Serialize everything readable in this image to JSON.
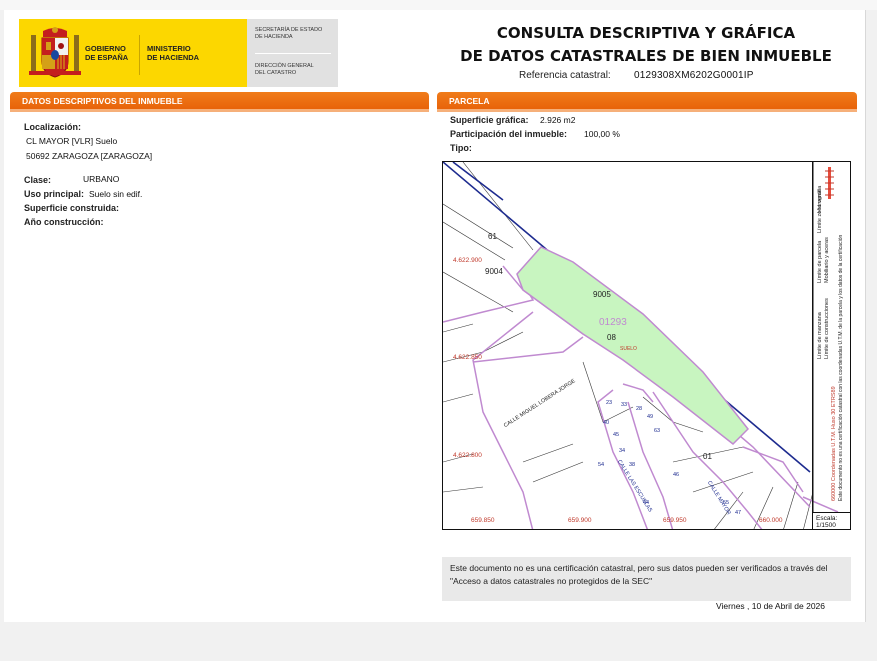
{
  "header": {
    "gov_line1": "GOBIERNO",
    "gov_line2": "DE ESPAÑA",
    "ministry_line1": "MINISTERIO",
    "ministry_line2": "DE HACIENDA",
    "secretaria_line1": "SECRETARÍA DE ESTADO",
    "secretaria_line2": "DE HACIENDA",
    "direccion_line1": "DIRECCIÓN GENERAL",
    "direccion_line2": "DEL CATASTRO",
    "title_line1": "CONSULTA DESCRIPTIVA Y GRÁFICA",
    "title_line2": "DE DATOS CATASTRALES DE BIEN INMUEBLE",
    "ref_label": "Referencia catastral:",
    "ref_value": "0129308XM6202G0001IP"
  },
  "left": {
    "section_title": "DATOS DESCRIPTIVOS DEL INMUEBLE",
    "localizacion_label": "Localización:",
    "address_line1": "CL MAYOR [VLR]  Suelo",
    "address_line2": "50692 ZARAGOZA [ZARAGOZA]",
    "clase_label": "Clase:",
    "clase_value": "URBANO",
    "uso_label": "Uso principal:",
    "uso_value": "Suelo sin edif.",
    "superficie_label": "Superficie construida:",
    "anio_label": "Año construcción:"
  },
  "right": {
    "section_title": "PARCELA",
    "superficie_label": "Superficie gráfica:",
    "superficie_value": "2.926 m2",
    "participacion_label": "Participación del inmueble:",
    "participacion_value": "100,00 %",
    "tipo_label": "Tipo:"
  },
  "map": {
    "parcel_fill": "#c8f5c0",
    "boundary_color": "#c08ad0",
    "road_color": "#1d2b8f",
    "coord_color": "#c0392b",
    "labels": {
      "p61": "61",
      "p9004": "9004",
      "p9005": "9005",
      "parcel_id": "01293",
      "p08": "08",
      "suelo": "SUELO",
      "p01": "01",
      "street1": "CALLE MIGUEL LOBERA JORGE",
      "street2": "CALLE LAS ESCUELAS",
      "street3": "CALLE MAYOR",
      "n1": "23",
      "n2": "33",
      "n3": "28",
      "n4": "49",
      "n5": "63",
      "n6": "40",
      "n7": "45",
      "n8": "34",
      "n9": "38",
      "n10": "46",
      "n11": "54",
      "n12": "55",
      "n13": "47",
      "n14": "44"
    },
    "coords": {
      "y1": "4.622.900",
      "y2": "4.622.850",
      "y3": "4.622.800",
      "x1": "659.850",
      "x2": "659.900",
      "x3": "659.950",
      "x4": "660.000"
    },
    "legend": {
      "l1": "Límite de manzana",
      "l2": "Límite de parcela",
      "l3": "Límite de construcciones",
      "l4": "Mobiliario y aceras",
      "l5": "Límite zona verde",
      "l6": "Hidrografía",
      "coords_note": "660000 Coordenadas U.T.M. Huso 30 ETRS89",
      "doc_note": "Este documento no es una certificación catastral con las coordenadas U.T.M. de la parcela y los datos de la certificación",
      "scale_label": "Escala:",
      "scale_value": "1/1500"
    }
  },
  "footer": {
    "notice": "Este documento no es una certificación catastral, pero sus datos pueden ser verificados a través del \"Acceso a datos catastrales no protegidos de la SEC\"",
    "date": "Viernes , 10 de Abril de 2026"
  }
}
